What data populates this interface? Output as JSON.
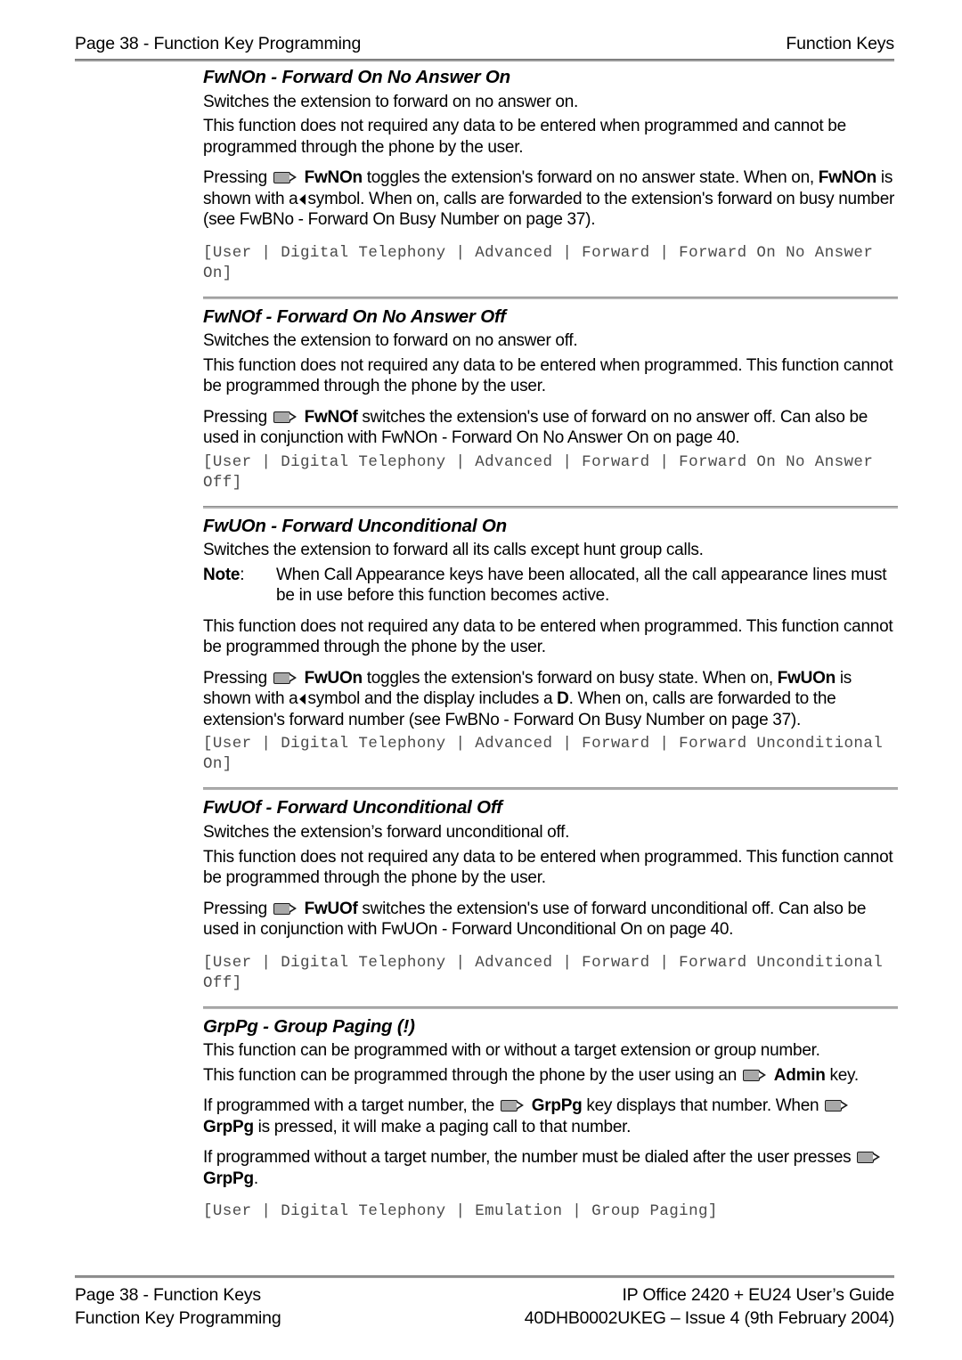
{
  "header": {
    "left": "Page 38 - Function Key Programming",
    "right": "Function Keys"
  },
  "footer": {
    "left_line1": "Page 38 - Function Keys",
    "left_line2": "Function Key Programming",
    "right_line1": "IP Office 2420 + EU24 User’s Guide",
    "right_line2": "40DHB0002UKEG – Issue 4 (9th February 2004)"
  },
  "icons": {
    "key": "phone-key-icon",
    "left_triangle": "left-triangle-symbol"
  },
  "sections": [
    {
      "id": "fwnon",
      "title": "FwNOn - Forward On No Answer On",
      "p1": "Switches the extension to forward on no answer on.",
      "p2": "This function does not required any data to be entered when programmed and cannot be programmed through the phone by the user.",
      "p3_a": "Pressing",
      "p3_b": "FwNOn",
      "p3_c": "toggles the extension's forward on no answer state. When on,",
      "p3_d": "FwNOn",
      "p3_e": "is shown with a",
      "p3_f": "symbol. When on, calls are forwarded to the extension's forward on busy number (see FwBNo - Forward On Busy Number on page 37).",
      "path": "[User | Digital Telephony | Advanced | Forward | Forward On No Answer On]"
    },
    {
      "id": "fwnof",
      "title": "FwNOf - Forward On No Answer Off",
      "p1": "Switches the extension to forward on no answer off.",
      "p2": "This function does not required any data to be entered when programmed. This function cannot be programmed through the phone by the user.",
      "p3_a": "Pressing",
      "p3_b": "FwNOf",
      "p3_c": "switches the extension's use of forward on no answer off. Can also be used in conjunction with FwNOn - Forward On No Answer On on page 40.",
      "path": "[User | Digital Telephony | Advanced | Forward | Forward On No Answer Off]"
    },
    {
      "id": "fwuon",
      "title": "FwUOn - Forward Unconditional On",
      "p1": "Switches the extension to forward all its calls except hunt group calls.",
      "note_label": "Note",
      "note_colon": ":",
      "note_text": "When Call Appearance keys have been allocated, all the call appearance lines must be in use before this function becomes active.",
      "p2": "This function does not required any data to be entered when programmed. This function cannot be programmed through the phone by the user.",
      "p3_a": "Pressing",
      "p3_b": "FwUOn",
      "p3_c": "toggles the extension's forward on busy state. When on,",
      "p3_d": "FwUOn",
      "p3_e": "is shown with a",
      "p3_f": "symbol and the display includes a",
      "p3_g": "D",
      "p3_h": ". When on, calls are forwarded to the extension's forward number (see FwBNo - Forward On Busy Number on page 37).",
      "path": "[User | Digital Telephony | Advanced | Forward | Forward Unconditional On]"
    },
    {
      "id": "fwuof",
      "title": "FwUOf - Forward Unconditional Off",
      "p1": "Switches the extension’s forward unconditional off.",
      "p2": "This function does not required any data to be entered when programmed. This function cannot be programmed through the phone by the user.",
      "p3_a": "Pressing",
      "p3_b": "FwUOf",
      "p3_c": "switches the extension's use of forward unconditional off. Can also be used in conjunction with FwUOn - Forward Unconditional On on page 40.",
      "path": "[User | Digital Telephony | Advanced | Forward | Forward Unconditional Off]"
    },
    {
      "id": "grppg",
      "title": "GrpPg - Group Paging (!)",
      "p1": "This function can be programmed with or without a target extension or group number.",
      "p2_a": "This function can be programmed through the phone by the user using an",
      "p2_b": "Admin",
      "p2_c": "key.",
      "p3_a": "If programmed with a target number, the",
      "p3_b": "GrpPg",
      "p3_c": "key displays that number. When",
      "p3_d": "GrpPg",
      "p3_e": "is pressed, it will make a paging call to that number.",
      "p4_a": "If programmed without a target number, the number must be dialed after the user presses",
      "p4_b": "GrpPg",
      "p4_c": ".",
      "path": "[User | Digital Telephony | Emulation | Group Paging]"
    }
  ]
}
